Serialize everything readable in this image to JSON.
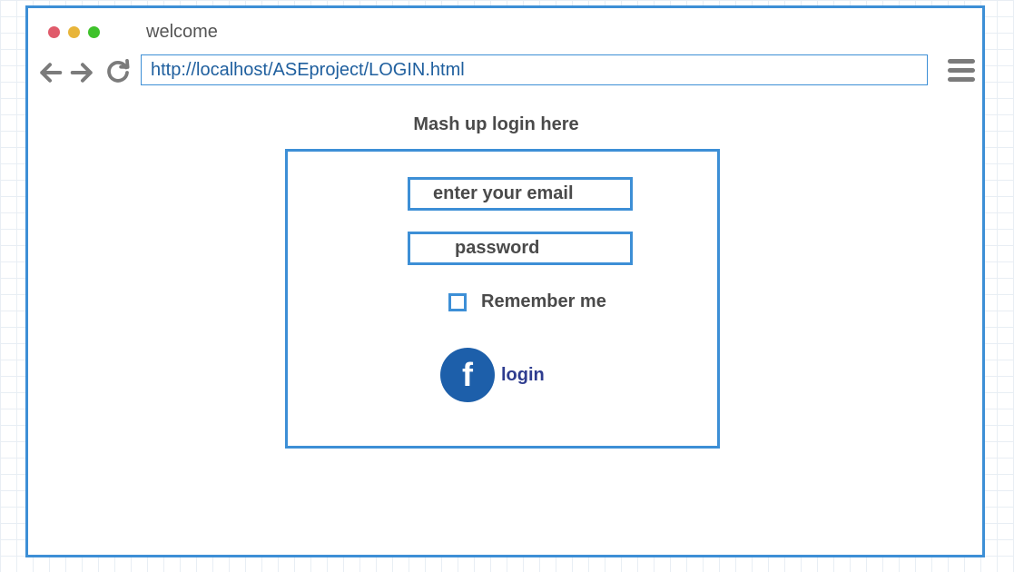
{
  "window": {
    "tab_title": "welcome",
    "traffic_lights": [
      "#e05b6b",
      "#e8b53a",
      "#3ec22b"
    ],
    "url": "http://localhost/ASEproject/LOGIN.html"
  },
  "nav": {
    "back_icon": "arrow-left-icon",
    "forward_icon": "arrow-right-icon",
    "reload_icon": "reload-icon",
    "menu_icon": "hamburger-menu-icon"
  },
  "page": {
    "heading": "Mash up login here"
  },
  "form": {
    "email_placeholder": "enter your email",
    "password_placeholder": "password",
    "remember_label": "Remember me",
    "remember_checked": false,
    "fb_glyph": "f",
    "login_label": "login"
  },
  "colors": {
    "accent": "#3d8fd6",
    "facebook": "#1d5faa",
    "login_text": "#2e3c8f"
  }
}
